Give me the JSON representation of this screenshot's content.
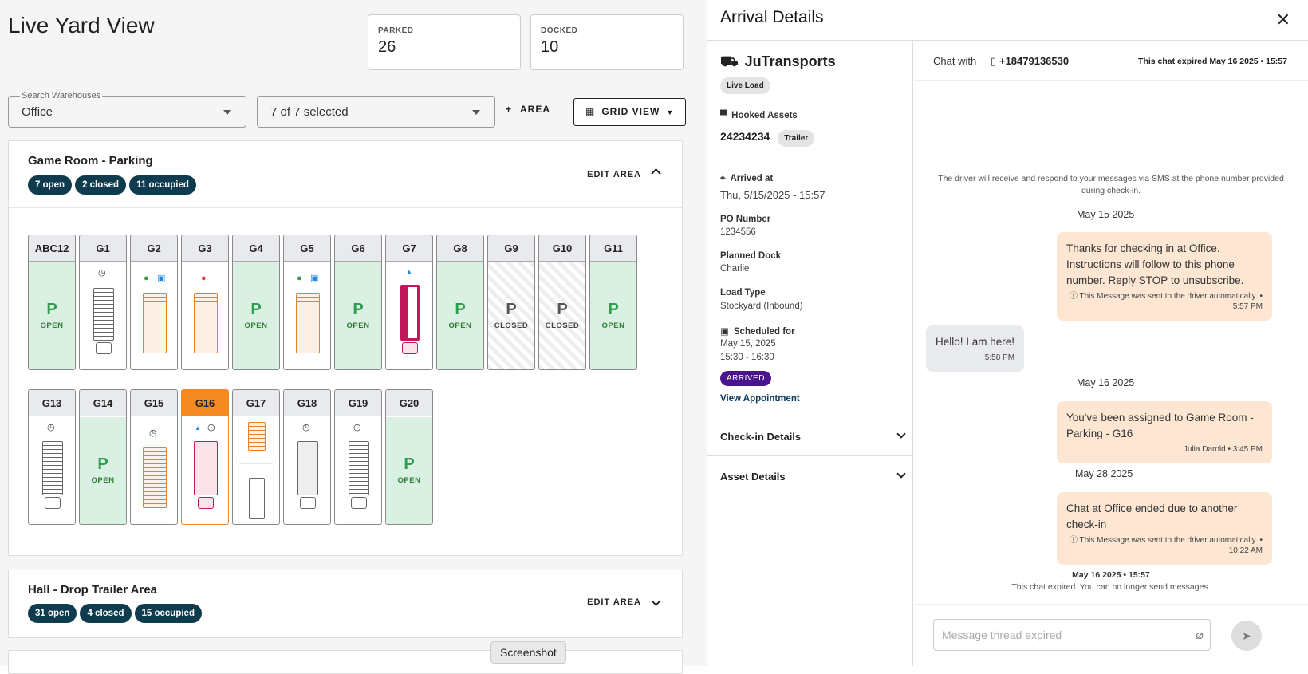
{
  "header": {
    "title": "Live Yard View"
  },
  "stats": [
    {
      "label": "PARKED",
      "value": "26"
    },
    {
      "label": "DOCKED",
      "value": "10"
    }
  ],
  "filters": {
    "warehouse_label": "Search Warehouses",
    "warehouse_value": "Office",
    "areas_value": "7 of 7 selected",
    "add_area": "AREA",
    "view_button": "GRID VIEW"
  },
  "areas": [
    {
      "name": "Game Room - Parking",
      "pills": [
        "7 open",
        "2 closed",
        "11 occupied"
      ],
      "edit": "EDIT AREA"
    },
    {
      "name": "Hall - Drop Trailer Area",
      "pills": [
        "31 open",
        "4 closed",
        "15 occupied"
      ],
      "edit": "EDIT AREA"
    }
  ],
  "spots": {
    "row1": [
      {
        "id": "ABC12",
        "status": "open",
        "p": "P",
        "text": "OPEN"
      },
      {
        "id": "G1",
        "status": "occupied"
      },
      {
        "id": "G2",
        "status": "occupied"
      },
      {
        "id": "G3",
        "status": "occupied"
      },
      {
        "id": "G4",
        "status": "open",
        "p": "P",
        "text": "OPEN"
      },
      {
        "id": "G5",
        "status": "occupied"
      },
      {
        "id": "G6",
        "status": "open",
        "p": "P",
        "text": "OPEN"
      },
      {
        "id": "G7",
        "status": "occupied"
      },
      {
        "id": "G8",
        "status": "open",
        "p": "P",
        "text": "OPEN"
      },
      {
        "id": "G9",
        "status": "closed",
        "p": "P",
        "text": "CLOSED"
      },
      {
        "id": "G10",
        "status": "closed",
        "p": "P",
        "text": "CLOSED"
      },
      {
        "id": "G11",
        "status": "open",
        "p": "P",
        "text": "OPEN"
      }
    ],
    "row2": [
      {
        "id": "G13",
        "status": "occupied"
      },
      {
        "id": "G14",
        "status": "open",
        "p": "P",
        "text": "OPEN"
      },
      {
        "id": "G15",
        "status": "occupied"
      },
      {
        "id": "G16",
        "status": "occupied"
      },
      {
        "id": "G17",
        "status": "occupied"
      },
      {
        "id": "G18",
        "status": "occupied"
      },
      {
        "id": "G19",
        "status": "occupied"
      },
      {
        "id": "G20",
        "status": "open",
        "p": "P",
        "text": "OPEN"
      }
    ]
  },
  "details": {
    "title": "Arrival Details",
    "carrier": "JuTransports",
    "load_chip": "Live Load",
    "hooked_label": "Hooked Assets",
    "hooked_value": "24234234",
    "hooked_chip": "Trailer",
    "arrived_label": "Arrived at",
    "arrived_value": "Thu, 5/15/2025 - 15:57",
    "po_label": "PO Number",
    "po_value": "1234556",
    "dock_label": "Planned Dock",
    "dock_value": "Charlie",
    "loadtype_label": "Load Type",
    "loadtype_value": "Stockyard (Inbound)",
    "sched_label": "Scheduled for",
    "sched_date": "May 15, 2025",
    "sched_time": "15:30 - 16:30",
    "status": "ARRIVED",
    "view_link": "View Appointment",
    "checkin": "Check-in Details",
    "asset": "Asset Details"
  },
  "chat": {
    "with_label": "Chat with",
    "phone": "+18479136530",
    "expired": "This chat expired May 16 2025 • 15:57",
    "notice": "The driver will receive and respond to your messages via SMS at the phone number provided during check-in.",
    "d1": "May 15 2025",
    "m1": "Thanks for checking in at Office. Instructions will follow to this phone number. Reply STOP to unsubscribe.",
    "m1_meta": "ⓘ This Message was sent to the driver automatically. • 5:57 PM",
    "m2": "Hello! I am here!",
    "m2_meta": "5:58 PM",
    "d2": "May 16 2025",
    "m3": "You've been assigned to Game Room - Parking - G16",
    "m3_meta": "Julia Darold • 3:45 PM",
    "d3": "May 28 2025",
    "m4": "Chat at Office ended due to another check-in",
    "m4_meta": "ⓘ This Message was sent to the driver automatically. • 10:22 AM",
    "end_time": "May 16 2025 • 15:57",
    "end_note": "This chat expired. You can no longer send messages.",
    "placeholder": "Message thread expired"
  },
  "tooltip": "Screenshot"
}
